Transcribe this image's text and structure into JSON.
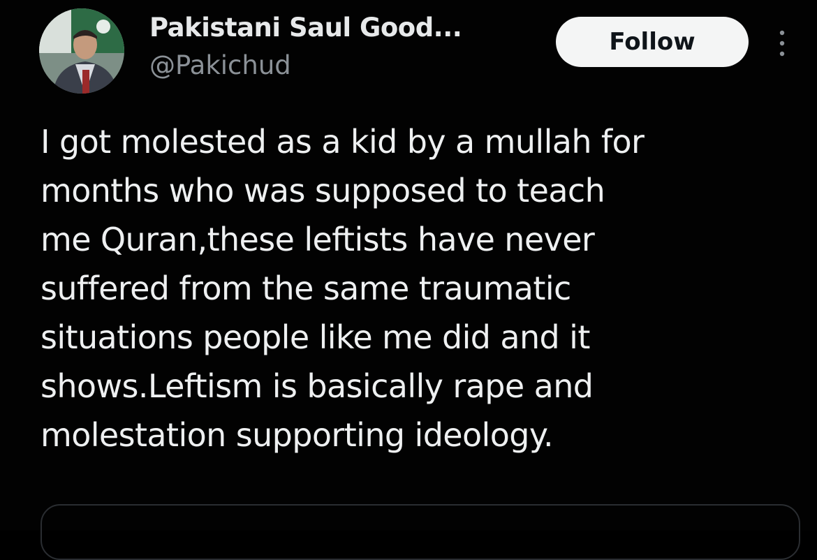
{
  "author": {
    "display_name": "Pakistani Saul Good...",
    "handle": "@Pakichud",
    "avatar_icon": "profile-photo"
  },
  "actions": {
    "follow_label": "Follow",
    "more_icon": "more-vertical-icon"
  },
  "tweet": {
    "lines": [
      "I got molested as a kid by a mullah for",
      "months who was supposed to teach",
      "me Quran,these leftists have never",
      "suffered from the same traumatic",
      "situations people like me did and it",
      "shows.Leftism is basically rape and",
      "molestation supporting ideology."
    ]
  },
  "colors": {
    "background": "#020202",
    "text_primary": "#e7e9ea",
    "text_secondary": "#8b9197",
    "follow_bg": "#f4f5f5",
    "follow_text": "#0f1419",
    "card_border": "#2a2d31"
  }
}
